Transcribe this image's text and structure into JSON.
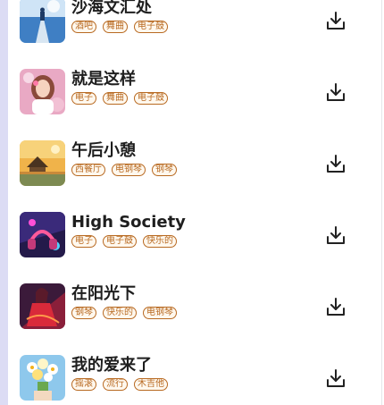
{
  "songs": [
    {
      "title": "沙海文汇处",
      "tags": [
        "酒吧",
        "舞曲",
        "电子鼓"
      ],
      "thumb": "sea-pier-art-thumbnail"
    },
    {
      "title": "就是这样",
      "tags": [
        "电子",
        "舞曲",
        "电子鼓"
      ],
      "thumb": "girl-portrait-thumbnail"
    },
    {
      "title": "午后小憩",
      "tags": [
        "西餐厅",
        "电钢琴",
        "钢琴"
      ],
      "thumb": "lake-cabin-thumbnail"
    },
    {
      "title": "High Society",
      "tags": [
        "电子",
        "电子鼓",
        "快乐的"
      ],
      "thumb": "neon-headphones-thumbnail"
    },
    {
      "title": "在阳光下",
      "tags": [
        "钢琴",
        "快乐的",
        "电钢琴"
      ],
      "thumb": "red-dancer-thumbnail"
    },
    {
      "title": "我的爱来了",
      "tags": [
        "摇滚",
        "流行",
        "木吉他"
      ],
      "thumb": "flower-bouquet-thumbnail"
    }
  ],
  "icons": {
    "download": "download-icon"
  },
  "colors": {
    "tag": "#b86a22",
    "title": "#1e1e1e",
    "left_strip": "#dcdcf4"
  }
}
